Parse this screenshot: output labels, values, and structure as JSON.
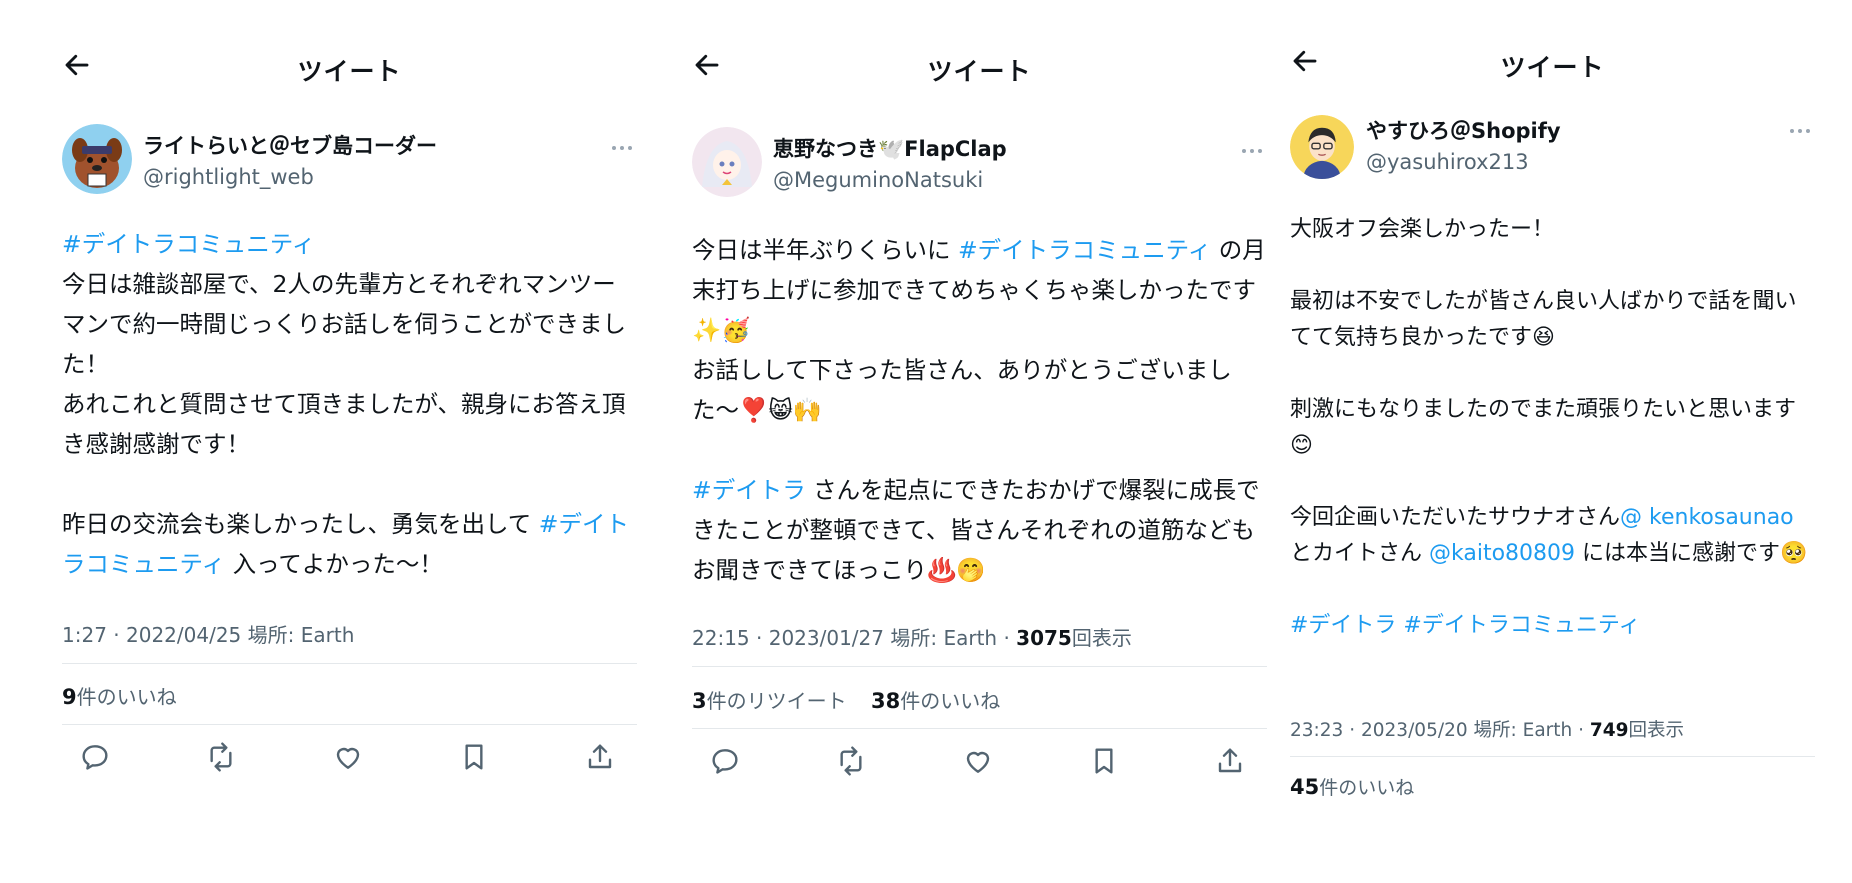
{
  "common": {
    "back_icon": "arrow-left-icon",
    "more_icon": "more-horizontal-icon",
    "action_icons": [
      "reply-icon",
      "retweet-icon",
      "like-icon",
      "bookmark-icon",
      "share-icon"
    ],
    "hashtag_color": "#1d9bf0",
    "muted_color": "#536471"
  },
  "tweets": [
    {
      "header_title": "ツイート",
      "display_name": "ライトらいと＠セブ島コーダー",
      "handle": "@rightlight_web",
      "avatar": "dog-avatar",
      "body": [
        {
          "t": "#デイトラコミュニティ",
          "tag": true
        },
        {
          "t": "\n今日は雑談部屋で、2人の先輩方とそれぞれマンツーマンで約一時間じっくりお話しを伺うことができました！\nあれこれと質問させて頂きましたが、親身にお答え頂き感謝感謝です！\n\n昨日の交流会も楽しかったし、勇気を出して "
        },
        {
          "t": "#デイトラコミュニティ",
          "tag": true
        },
        {
          "t": " 入ってよかった〜！"
        }
      ],
      "meta": {
        "time": "1:27",
        "date": "2022/04/25",
        "location": "場所: Earth"
      },
      "stats": [
        {
          "count": "9",
          "label": "件のいいね"
        }
      ]
    },
    {
      "header_title": "ツイート",
      "display_name": "恵野なつき🕊️FlapClap",
      "handle": "@MeguminoNatsuki",
      "avatar": "anime-girl-avatar",
      "body": [
        {
          "t": "今日は半年ぶりくらいに "
        },
        {
          "t": "#デイトラコミュニティ",
          "tag": true
        },
        {
          "t": " の月末打ち上げに参加できてめちゃくちゃ楽しかったです✨🥳\nお話しして下さった皆さん、ありがとうございました〜❣️😸🙌\n\n"
        },
        {
          "t": "#デイトラ",
          "tag": true
        },
        {
          "t": " さんを起点にできたおかげで爆裂に成長できたことが整頓できて、皆さんそれぞれの道筋などもお聞きできてほっこり♨️🤭"
        }
      ],
      "meta": {
        "time": "22:15",
        "date": "2023/01/27",
        "location": "場所: Earth",
        "views": "3075",
        "views_label": "回表示"
      },
      "stats": [
        {
          "count": "3",
          "label": "件のリツイート"
        },
        {
          "count": "38",
          "label": "件のいいね"
        }
      ]
    },
    {
      "header_title": "ツイート",
      "display_name": "やすひろ＠Shopify",
      "handle": "@yasuhirox213",
      "avatar": "man-glasses-avatar",
      "body": [
        {
          "t": "大阪オフ会楽しかったー！\n\n最初は不安でしたが皆さん良い人ばかりで話を聞いてて気持ち良かったです😆\n\n刺激にもなりましたのでまた頑張りたいと思います😊\n\n今回企画いただいたサウナオさん"
        },
        {
          "t": "@ kenkosaunao",
          "tag": true
        },
        {
          "t": "\nとカイトさん "
        },
        {
          "t": "@kaito80809",
          "tag": true
        },
        {
          "t": " には本当に感謝です🥺\n\n"
        },
        {
          "t": "#デイトラ #デイトラコミュニティ",
          "tag": true
        }
      ],
      "meta": {
        "time": "23:23",
        "date": "2023/05/20",
        "location": "場所: Earth",
        "views": "749",
        "views_label": "回表示"
      },
      "stats": [
        {
          "count": "45",
          "label": "件のいいね"
        }
      ]
    }
  ]
}
